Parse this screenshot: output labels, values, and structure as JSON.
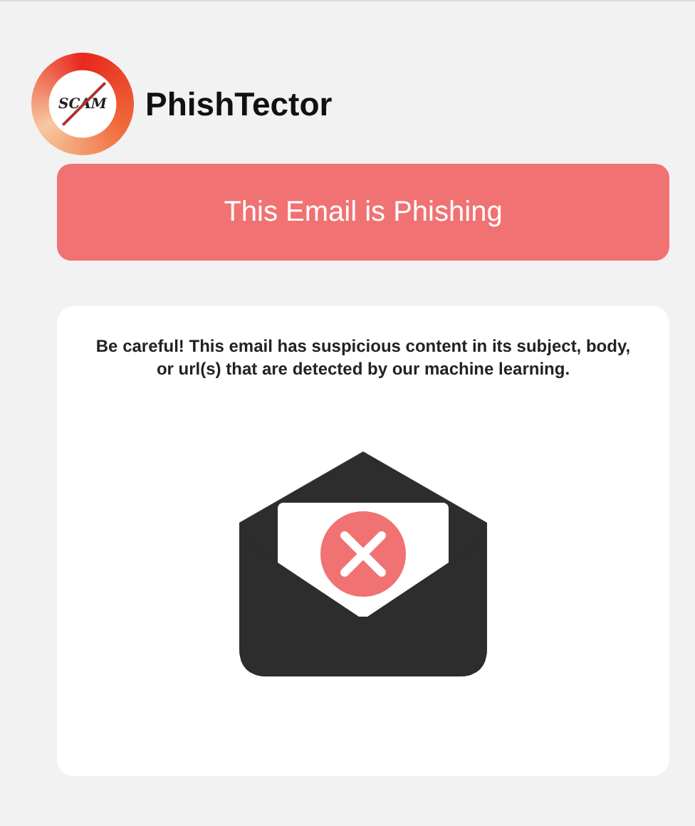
{
  "app": {
    "logo_text": "SCAM",
    "name": "PhishTector"
  },
  "result": {
    "verdict": "This Email is Phishing",
    "message": "Be careful! This email has suspicious content in its subject, body, or url(s) that are detected by our machine learning."
  }
}
